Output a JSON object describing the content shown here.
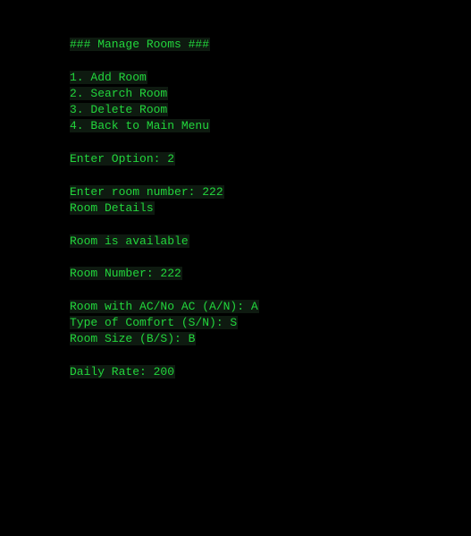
{
  "header": "### Manage Rooms ###",
  "menu": [
    "1. Add Room",
    "2. Search Room",
    "3. Delete Room",
    "4. Back to Main Menu"
  ],
  "option_prompt": "Enter Option: 2",
  "room_number_prompt": "Enter room number: 222",
  "details_heading": "Room Details",
  "availability": "Room is available",
  "room_number": "Room Number: 222",
  "ac": "Room with AC/No AC (A/N): A",
  "comfort": "Type of Comfort (S/N): S",
  "size": "Room Size (B/S): B",
  "daily_rate": "Daily Rate: 200",
  "colors": {
    "text": "#22d63c",
    "background": "#000000"
  }
}
